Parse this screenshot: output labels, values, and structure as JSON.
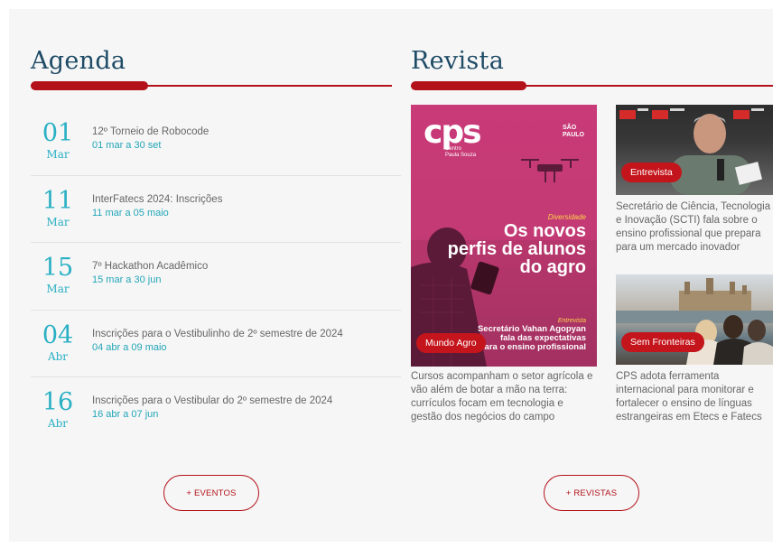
{
  "agenda": {
    "title": "Agenda",
    "events": [
      {
        "day": "01",
        "month": "Mar",
        "name": "12º Torneio de Robocode",
        "date": "01 mar a 30 set"
      },
      {
        "day": "11",
        "month": "Mar",
        "name": "InterFatecs 2024: Inscrições",
        "date": "11 mar a 05 maio"
      },
      {
        "day": "15",
        "month": "Mar",
        "name": "7º Hackathon Acadêmico",
        "date": "15 mar a 30 jun"
      },
      {
        "day": "04",
        "month": "Abr",
        "name": "Inscrições para o Vestibulinho de 2º semestre de 2024",
        "date": "04 abr a 09 maio"
      },
      {
        "day": "16",
        "month": "Abr",
        "name": "Inscrições para o Vestibular do 2º semestre de 2024",
        "date": "16 abr a 07 jun"
      }
    ],
    "button_label": "+ EVENTOS"
  },
  "revista": {
    "title": "Revista",
    "cover": {
      "logo": "cps",
      "logo_sub_1": "Centro",
      "logo_sub_2": "Paula Souza",
      "sp_1": "SÃO",
      "sp_2": "PAULO",
      "section_label": "Diversidade",
      "headline_1": "Os novos",
      "headline_2": "perfis de alunos",
      "headline_3": "do agro",
      "interview_label": "Entrevista",
      "subhead_1": "Secretário Vahan Agopyan",
      "subhead_2": "fala das expectativas",
      "subhead_3": "para o ensino profissional",
      "tag": "Mundo Agro",
      "caption": "Cursos acompanham o setor agrícola e vão além de botar a mão na terra: currículos focam em tecnologia e gestão dos negócios do campo"
    },
    "articles": [
      {
        "tag": "Entrevista",
        "caption": "Secretário de Ciência, Tecnologia e Inovação (SCTI) fala sobre o ensino profissional que prepara para um mercado inovador"
      },
      {
        "tag": "Sem Fronteiras",
        "caption": "CPS adota ferramenta internacional para monitorar e fortalecer o ensino de línguas estrangeiras em Etecs e Fatecs"
      }
    ],
    "button_label": "+ REVISTAS"
  }
}
